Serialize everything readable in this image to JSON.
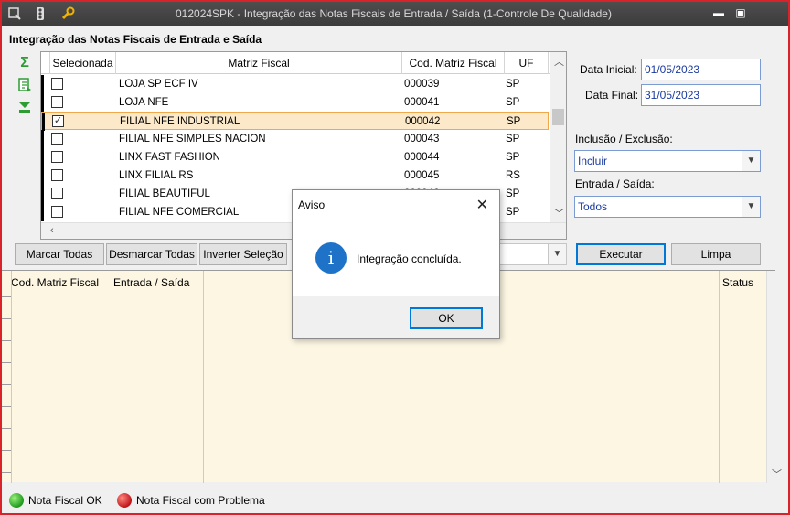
{
  "window": {
    "title": "012024SPK - Integração das Notas Fiscais de Entrada / Saída (1-Controle De Qualidade)",
    "minimize_glyph": "▬",
    "maximize_glyph": "▣"
  },
  "section_title": "Integração das Notas Fiscais de Entrada e Saída",
  "toolbar_icons": [
    "sum-icon",
    "export-icon",
    "filter-icon"
  ],
  "grid": {
    "columns": [
      "Selecionada",
      "Matriz Fiscal",
      "Cod. Matriz Fiscal",
      "UF"
    ],
    "rows": [
      {
        "checked": false,
        "matriz": "LOJA SP ECF IV",
        "cod": "000039",
        "uf": "SP",
        "selected": false
      },
      {
        "checked": false,
        "matriz": "LOJA NFE",
        "cod": "000041",
        "uf": "SP",
        "selected": false
      },
      {
        "checked": true,
        "matriz": "FILIAL NFE INDUSTRIAL",
        "cod": "000042",
        "uf": "SP",
        "selected": true
      },
      {
        "checked": false,
        "matriz": "FILIAL NFE SIMPLES NACION",
        "cod": "000043",
        "uf": "SP",
        "selected": false
      },
      {
        "checked": false,
        "matriz": "LINX FAST FASHION",
        "cod": "000044",
        "uf": "SP",
        "selected": false
      },
      {
        "checked": false,
        "matriz": "LINX FILIAL RS",
        "cod": "000045",
        "uf": "RS",
        "selected": false
      },
      {
        "checked": false,
        "matriz": "FILIAL BEAUTIFUL",
        "cod": "000046",
        "uf": "SP",
        "selected": false
      },
      {
        "checked": false,
        "matriz": "FILIAL NFE COMERCIAL",
        "cod": "",
        "uf": "SP",
        "selected": false
      }
    ]
  },
  "filters": {
    "data_inicial_label": "Data Inicial:",
    "data_inicial_value": "01/05/2023",
    "data_final_label": "Data Final:",
    "data_final_value": "31/05/2023",
    "inclusao_label": "Inclusão / Exclusão:",
    "inclusao_value": "Incluir",
    "entrada_label": "Entrada / Saída:",
    "entrada_value": "Todos"
  },
  "buttons": {
    "marcar": "Marcar Todas",
    "desmarcar": "Desmarcar Todas",
    "inverter": "Inverter Seleção",
    "executar": "Executar",
    "limpa": "Limpa"
  },
  "result_grid": {
    "columns": [
      "Cod. Matriz Fiscal",
      "Entrada / Saída",
      "Status"
    ]
  },
  "legend": {
    "ok": "Nota Fiscal OK",
    "problem": "Nota Fiscal com Problema"
  },
  "dialog": {
    "title": "Aviso",
    "close_glyph": "✕",
    "icon_glyph": "i",
    "message": "Integração concluída.",
    "ok_label": "OK"
  }
}
